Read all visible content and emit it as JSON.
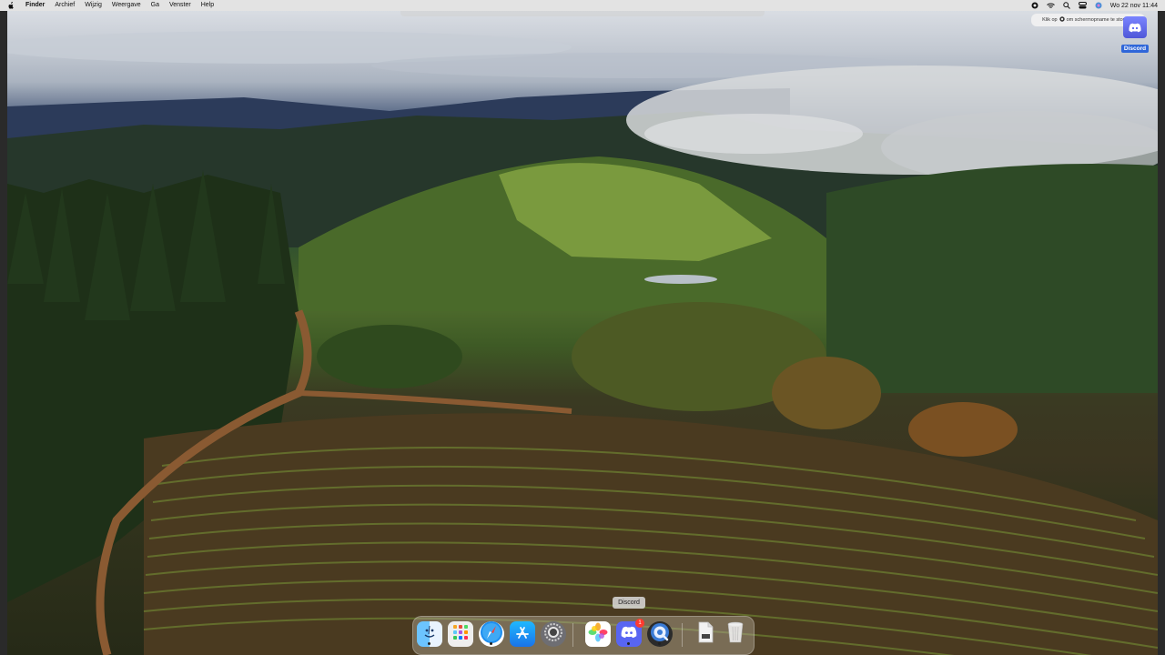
{
  "menubar": {
    "items": [
      "Finder",
      "Archief",
      "Wijzig",
      "Weergave",
      "Ga",
      "Venster",
      "Help"
    ],
    "status": {
      "datetime": "Wo 22 nov  11:44"
    }
  },
  "notification": {
    "text_before": "Klik op",
    "text_after": "om schermopname te stoppen"
  },
  "desktop_icon": {
    "label": "Discord"
  },
  "dock": {
    "tooltip": "Discord",
    "apps": [
      {
        "name": "Finder",
        "icon": "finder-icon",
        "running": true
      },
      {
        "name": "Launchpad",
        "icon": "launchpad-icon",
        "running": false
      },
      {
        "name": "Safari",
        "icon": "safari-icon",
        "running": true
      },
      {
        "name": "App Store",
        "icon": "app-store-icon",
        "running": false
      },
      {
        "name": "Systeeminstellingen",
        "icon": "system-settings-icon",
        "running": false
      },
      {
        "name": "Foto's",
        "icon": "photos-icon",
        "running": false
      },
      {
        "name": "Discord",
        "icon": "discord-icon",
        "running": true,
        "badge": "1"
      },
      {
        "name": "QuickTime Player",
        "icon": "quicktime-icon",
        "running": true
      },
      {
        "name": "Document",
        "icon": "document-icon",
        "running": false
      },
      {
        "name": "Prullenmand",
        "icon": "trash-icon",
        "running": false
      }
    ]
  },
  "colors": {
    "accent": "#2f66d9",
    "badge": "#ff3b30",
    "discord": "#5865f2"
  }
}
